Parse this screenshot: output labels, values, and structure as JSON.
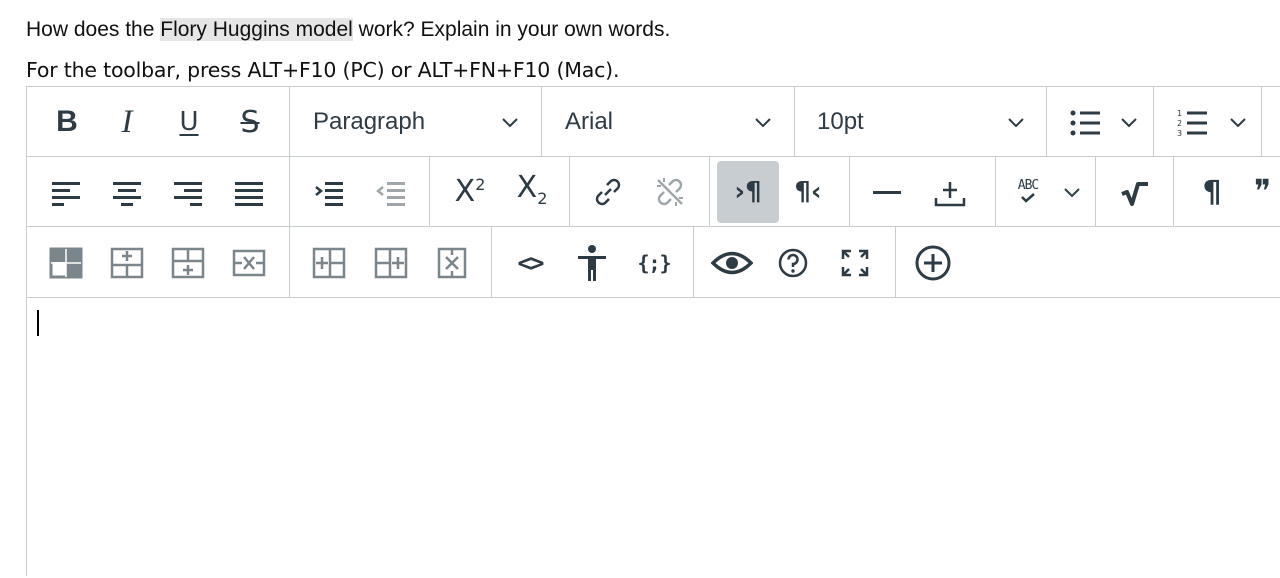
{
  "question": {
    "before": "How does the ",
    "highlight": "Flory Huggins model",
    "after": " work? Explain in your own words."
  },
  "hint": "For the toolbar, press ALT+F10 (PC) or ALT+FN+F10 (Mac).",
  "toolbar": {
    "bold_label": "B",
    "italic_label": "I",
    "underline_label": "U",
    "strike_label": "S",
    "block_format": "Paragraph",
    "font_family": "Arial",
    "font_size": "10pt",
    "superscript_label": "X",
    "superscript_mark": "2",
    "subscript_label": "X",
    "subscript_mark": "2",
    "spellcheck_label": "ABC",
    "paragraph_mark": "¶",
    "ltr_label": "¶",
    "rtl_label": "¶",
    "quote_label": "❞",
    "code_label": "<>",
    "braces_label": "{;}"
  },
  "colors": {
    "icon": "#2d3b45",
    "border": "#c7cdd1",
    "active_bg": "#c7cdd1",
    "highlight_bg": "#e6e6e6"
  }
}
